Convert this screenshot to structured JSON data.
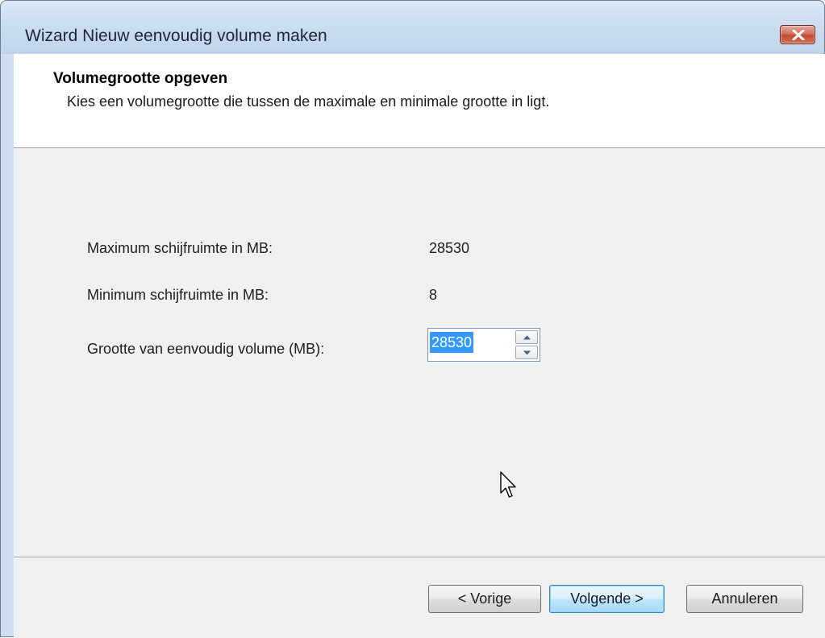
{
  "window": {
    "title": "Wizard Nieuw eenvoudig volume maken"
  },
  "header": {
    "title": "Volumegrootte opgeven",
    "subtitle": "Kies een volumegrootte die tussen de maximale en minimale grootte in ligt."
  },
  "fields": {
    "max_label": "Maximum schijfruimte in MB:",
    "max_value": "28530",
    "min_label": "Minimum schijfruimte in MB:",
    "min_value": "8",
    "size_label": "Grootte van eenvoudig volume (MB):",
    "size_value": "28530"
  },
  "buttons": {
    "back": "< Vorige",
    "next": "Volgende >",
    "cancel": "Annuleren"
  },
  "icons": {
    "close": "close-icon",
    "spin_up": "arrow-up-icon",
    "spin_down": "arrow-down-icon",
    "cursor": "mouse-pointer-icon"
  },
  "colors": {
    "selection": "#3399ff",
    "close_button": "#c24a33",
    "default_button_border": "#3c7fb1"
  }
}
